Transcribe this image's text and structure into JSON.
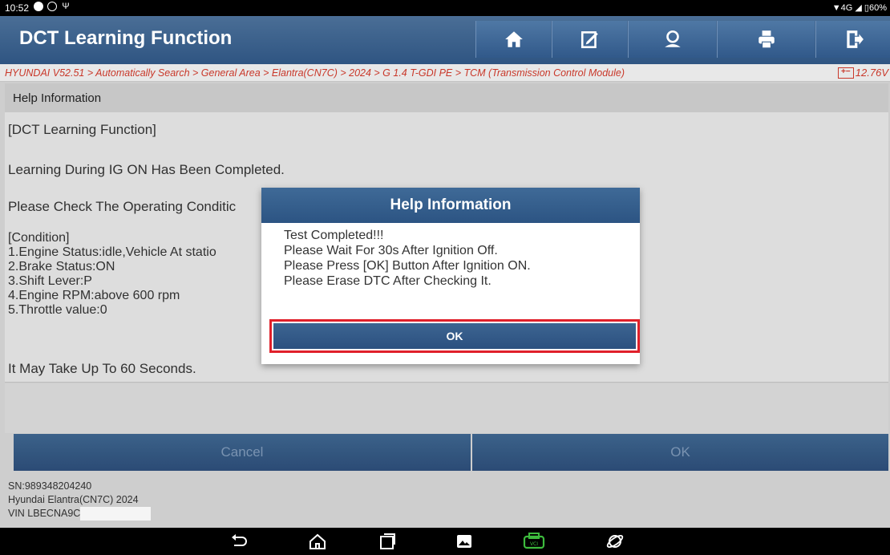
{
  "status_bar": {
    "time": "10:52",
    "signal": "4G",
    "battery": "60%"
  },
  "header": {
    "title": "DCT Learning Function",
    "toolbar": [
      "home-icon",
      "edit-icon",
      "user-icon",
      "print-icon",
      "exit-icon"
    ]
  },
  "breadcrumb": {
    "path": "HYUNDAI V52.51 > Automatically Search > General Area > Elantra(CN7C) > 2024 > G 1.4 T-GDI PE > TCM (Transmission Control Module)",
    "voltage": "12.76V"
  },
  "section": {
    "title": "Help Information"
  },
  "content": {
    "heading": "[DCT Learning Function]",
    "line1": "Learning During IG ON Has Been Completed.",
    "line2": "Please Check The Operating Conditic",
    "condition": "[Condition]\n1.Engine Status:idle,Vehicle At statio\n2.Brake Status:ON\n3.Shift Lever:P\n4.Engine RPM:above 600 rpm\n5.Throttle value:0",
    "footer": "It May Take Up To 60 Seconds."
  },
  "buttons": {
    "cancel": "Cancel",
    "ok": "OK"
  },
  "vehicle_info": {
    "sn": "SN:989348204240",
    "model": "Hyundai Elantra(CN7C) 2024",
    "vin": "VIN LBECNA9C"
  },
  "dialog": {
    "title": "Help Information",
    "lines": [
      "Test Completed!!!",
      "Please Wait For 30s After Ignition Off.",
      "Please Press [OK] Button After Ignition ON.",
      "Please Erase DTC After Checking It."
    ],
    "ok_label": "OK"
  },
  "colors": {
    "header_blue": "#2f5582",
    "breadcrumb_red": "#d23b2c",
    "highlight_red": "#e0202a",
    "vci_green": "#3dbb3d"
  }
}
